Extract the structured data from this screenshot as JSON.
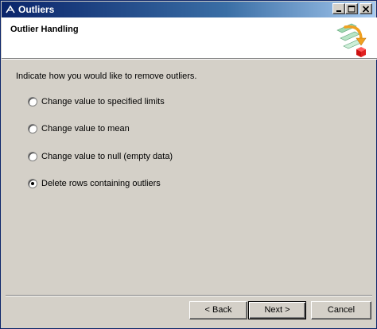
{
  "window": {
    "title": "Outliers",
    "title_icon": "tool-icon",
    "controls": [
      "minimize-icon",
      "maximize-icon",
      "close-icon"
    ]
  },
  "header": {
    "title": "Outlier Handling",
    "graphic": "wizard-graphic-icon"
  },
  "content": {
    "prompt": "Indicate how you would like to remove outliers.",
    "options": [
      {
        "label": "Change value to specified limits",
        "checked": false
      },
      {
        "label": "Change value to mean",
        "checked": false
      },
      {
        "label": "Change value to null (empty data)",
        "checked": false
      },
      {
        "label": "Delete rows containing outliers",
        "checked": true
      }
    ]
  },
  "buttons": {
    "back": "< Back",
    "next": "Next >",
    "cancel": "Cancel"
  },
  "colors": {
    "title_bar_start": "#0a246a",
    "title_bar_end": "#a6caf0",
    "dialog_face": "#d4d0c8",
    "header_bg": "#ffffff"
  }
}
